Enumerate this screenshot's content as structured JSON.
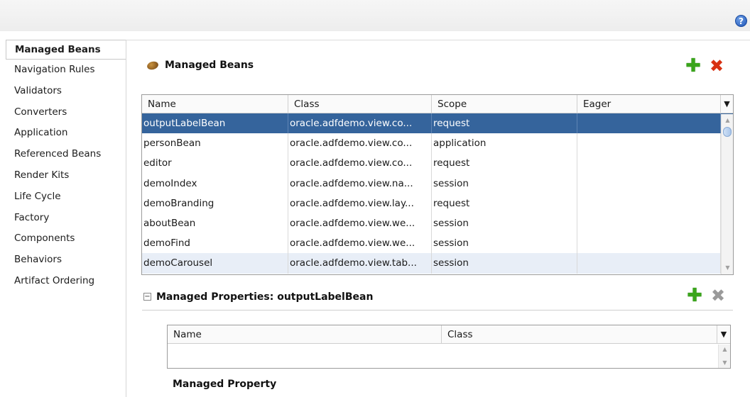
{
  "help": {
    "glyph": "?"
  },
  "sidebar": {
    "items": [
      {
        "label": "Managed Beans"
      },
      {
        "label": "Navigation Rules"
      },
      {
        "label": "Validators"
      },
      {
        "label": "Converters"
      },
      {
        "label": "Application"
      },
      {
        "label": "Referenced Beans"
      },
      {
        "label": "Render Kits"
      },
      {
        "label": "Life Cycle"
      },
      {
        "label": "Factory"
      },
      {
        "label": "Components"
      },
      {
        "label": "Behaviors"
      },
      {
        "label": "Artifact Ordering"
      }
    ]
  },
  "beans": {
    "title": "Managed Beans",
    "columns": [
      "Name",
      "Class",
      "Scope",
      "Eager"
    ],
    "rows": [
      {
        "name": "outputLabelBean",
        "class": "oracle.adfdemo.view.co...",
        "scope": "request",
        "eager": ""
      },
      {
        "name": "personBean",
        "class": "oracle.adfdemo.view.co...",
        "scope": "application",
        "eager": ""
      },
      {
        "name": "editor",
        "class": "oracle.adfdemo.view.co...",
        "scope": "request",
        "eager": ""
      },
      {
        "name": "demoIndex",
        "class": "oracle.adfdemo.view.na...",
        "scope": "session",
        "eager": ""
      },
      {
        "name": "demoBranding",
        "class": "oracle.adfdemo.view.lay...",
        "scope": "request",
        "eager": ""
      },
      {
        "name": "aboutBean",
        "class": "oracle.adfdemo.view.we...",
        "scope": "session",
        "eager": ""
      },
      {
        "name": "demoFind",
        "class": "oracle.adfdemo.view.we...",
        "scope": "session",
        "eager": ""
      },
      {
        "name": "demoCarousel",
        "class": "oracle.adfdemo.view.tab...",
        "scope": "session",
        "eager": ""
      }
    ],
    "selected_row": "outputLabelBean"
  },
  "properties": {
    "collapse_glyph": "−",
    "title": "Managed Properties: outputLabelBean",
    "columns": [
      "Name",
      "Class"
    ],
    "footer_title": "Managed Property"
  },
  "icons": {
    "add": "✚",
    "delete": "✖",
    "menu": "▼",
    "up": "▲",
    "down": "▼"
  },
  "colors": {
    "selection": "#35649c",
    "add": "#3aa51c",
    "delete": "#d83112"
  }
}
